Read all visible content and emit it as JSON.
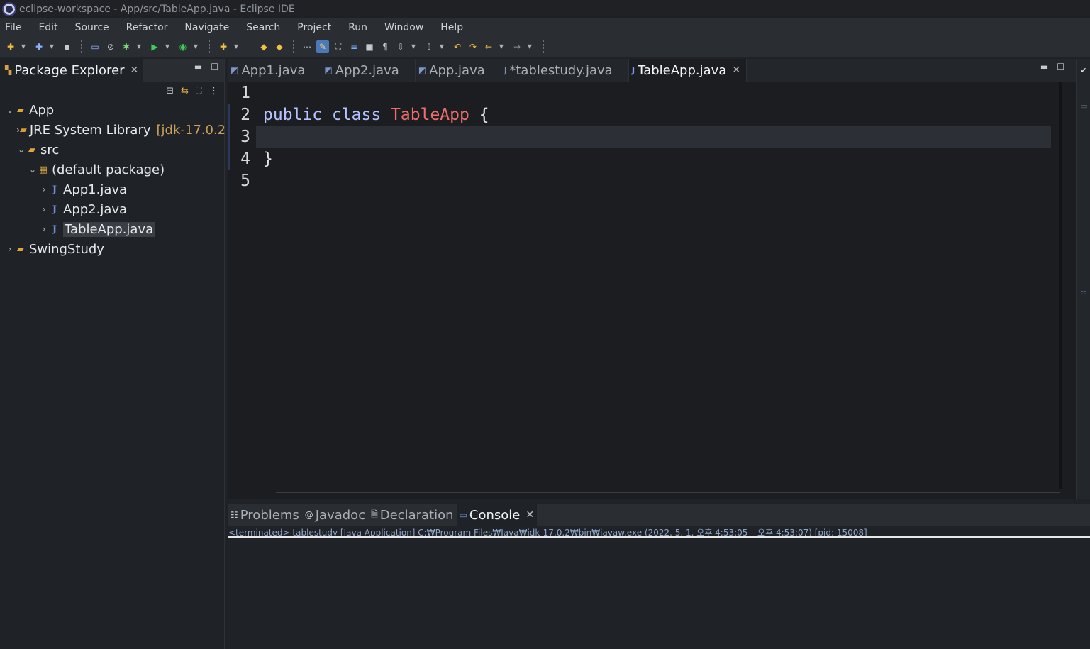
{
  "window": {
    "title": "eclipse-workspace - App/src/TableApp.java - Eclipse IDE"
  },
  "menu": [
    "File",
    "Edit",
    "Source",
    "Refactor",
    "Navigate",
    "Search",
    "Project",
    "Run",
    "Window",
    "Help"
  ],
  "package_explorer": {
    "tab_label": "Package Explorer",
    "tree": [
      {
        "label": "App",
        "twisty": "expanded",
        "icon": "project-icon",
        "indent": 0
      },
      {
        "label": "JRE System Library",
        "decoration": "[jdk-17.0.2",
        "twisty": "collapsed",
        "icon": "library-icon",
        "indent": 1
      },
      {
        "label": "src",
        "twisty": "expanded",
        "icon": "source-folder-icon",
        "indent": 1
      },
      {
        "label": "(default package)",
        "twisty": "expanded",
        "icon": "package-icon",
        "indent": 2
      },
      {
        "label": "App1.java",
        "twisty": "collapsed",
        "icon": "java-file-icon",
        "indent": 3
      },
      {
        "label": "App2.java",
        "twisty": "collapsed",
        "icon": "java-file-icon",
        "indent": 3
      },
      {
        "label": "TableApp.java",
        "twisty": "collapsed",
        "icon": "java-file-icon",
        "indent": 3,
        "selected": true
      },
      {
        "label": "SwingStudy",
        "twisty": "collapsed",
        "icon": "project-icon",
        "indent": 0
      }
    ]
  },
  "editor": {
    "tabs": [
      {
        "label": "App1.java",
        "active": false
      },
      {
        "label": "App2.java",
        "active": false
      },
      {
        "label": "App.java",
        "active": false
      },
      {
        "label": "*tablestudy.java",
        "active": false
      },
      {
        "label": "TableApp.java",
        "active": true
      }
    ],
    "line_numbers": [
      "1",
      "2",
      "3",
      "4",
      "5"
    ],
    "code": {
      "kw_public": "public",
      "kw_class": "class",
      "class_name": "TableApp",
      "open_brace": "{",
      "close_brace": "}"
    },
    "current_line": 3
  },
  "console": {
    "tabs": [
      "Problems",
      "Javadoc",
      "Declaration",
      "Console"
    ],
    "active_tab": "Console",
    "status": "<terminated> tablestudy [Java Application] C:₩Program Files₩Java₩jdk-17.0.2₩bin₩javaw.exe  (2022. 5. 1. 오후 4:53:05 – 오후 4:53:07) [pid: 15008]"
  },
  "colors": {
    "keyword": "#b5c2ff",
    "class_name": "#f06c6c",
    "editor_bg": "#1b1d21",
    "current_line": "#2c3036"
  }
}
